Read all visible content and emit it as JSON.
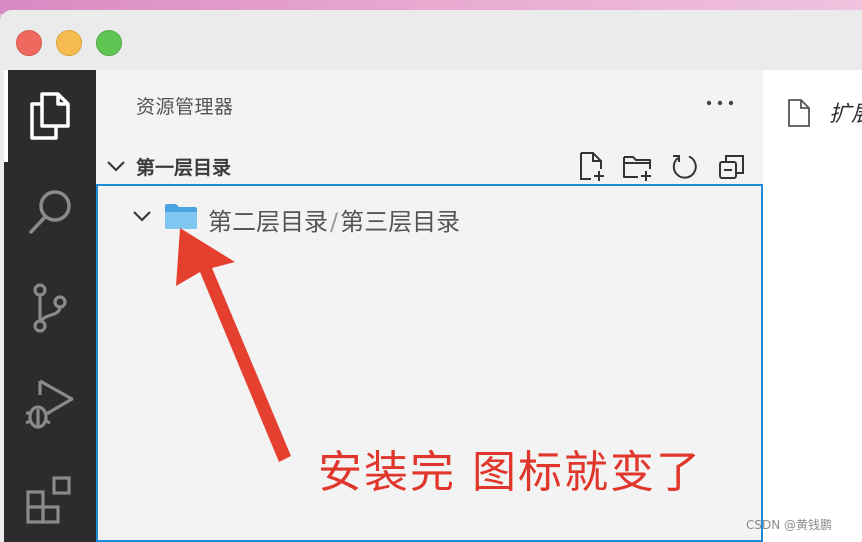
{
  "sidebar": {
    "title": "资源管理器",
    "more_label": "···",
    "section": {
      "title": "第一层目录",
      "actions": [
        {
          "icon": "new-file-icon"
        },
        {
          "icon": "new-folder-icon"
        },
        {
          "icon": "refresh-icon"
        },
        {
          "icon": "collapse-all-icon"
        }
      ]
    },
    "tree": {
      "folder_path": [
        "第二层目录",
        "第三层目录"
      ],
      "separator": "/"
    }
  },
  "activity_bar": {
    "items": [
      {
        "icon": "explorer-icon",
        "active": true
      },
      {
        "icon": "search-icon"
      },
      {
        "icon": "source-control-icon"
      },
      {
        "icon": "run-debug-icon"
      },
      {
        "icon": "extensions-icon"
      }
    ]
  },
  "editor": {
    "tab_label": "扩展"
  },
  "annotation": {
    "text": "安装完 图标就变了"
  },
  "watermark": "CSDN @黄钱鹏",
  "colors": {
    "activity_bar": "#2c2c2c",
    "sidebar": "#f3f3f3",
    "focus_border": "#1f8ad6",
    "annotation": "#e0362c",
    "folder": "#5fb4e8"
  }
}
